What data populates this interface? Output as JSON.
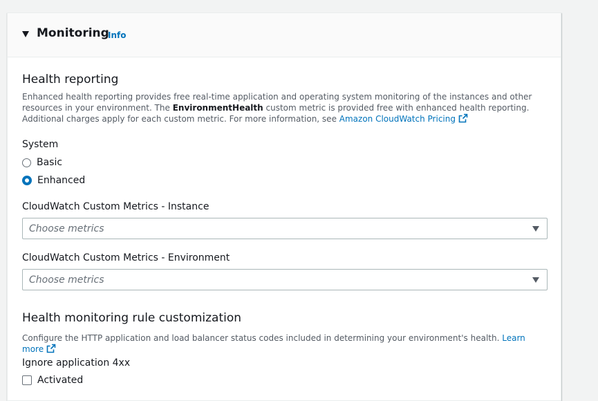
{
  "panel": {
    "title": "Monitoring",
    "info_link": "Info"
  },
  "health_reporting": {
    "title": "Health reporting",
    "desc_part1": "Enhanced health reporting provides free real-time application and operating system monitoring of the instances and other resources in your environment. The ",
    "desc_bold": "EnvironmentHealth",
    "desc_part2": " custom metric is provided free with enhanced health reporting. Additional charges apply for each custom metric. For more information, see ",
    "pricing_link": "Amazon CloudWatch Pricing",
    "system_label": "System",
    "options": [
      {
        "label": "Basic",
        "selected": false
      },
      {
        "label": "Enhanced",
        "selected": true
      }
    ],
    "instance_metrics_label": "CloudWatch Custom Metrics - Instance",
    "instance_metrics_placeholder": "Choose metrics",
    "environment_metrics_label": "CloudWatch Custom Metrics - Environment",
    "environment_metrics_placeholder": "Choose metrics"
  },
  "rule_customization": {
    "title": "Health monitoring rule customization",
    "desc": "Configure the HTTP application and load balancer status codes included in determining your environment's health.",
    "learn_more": "Learn more",
    "ignore_4xx_label": "Ignore application 4xx",
    "activated_label": "Activated"
  },
  "colors": {
    "link": "#0073bb",
    "text": "#16191f",
    "secondary_text": "#545b64",
    "header_bg": "#fafafa"
  },
  "icons": {
    "collapse": "caret-down-icon",
    "external": "external-link-icon",
    "dropdown": "chevron-down-icon"
  }
}
